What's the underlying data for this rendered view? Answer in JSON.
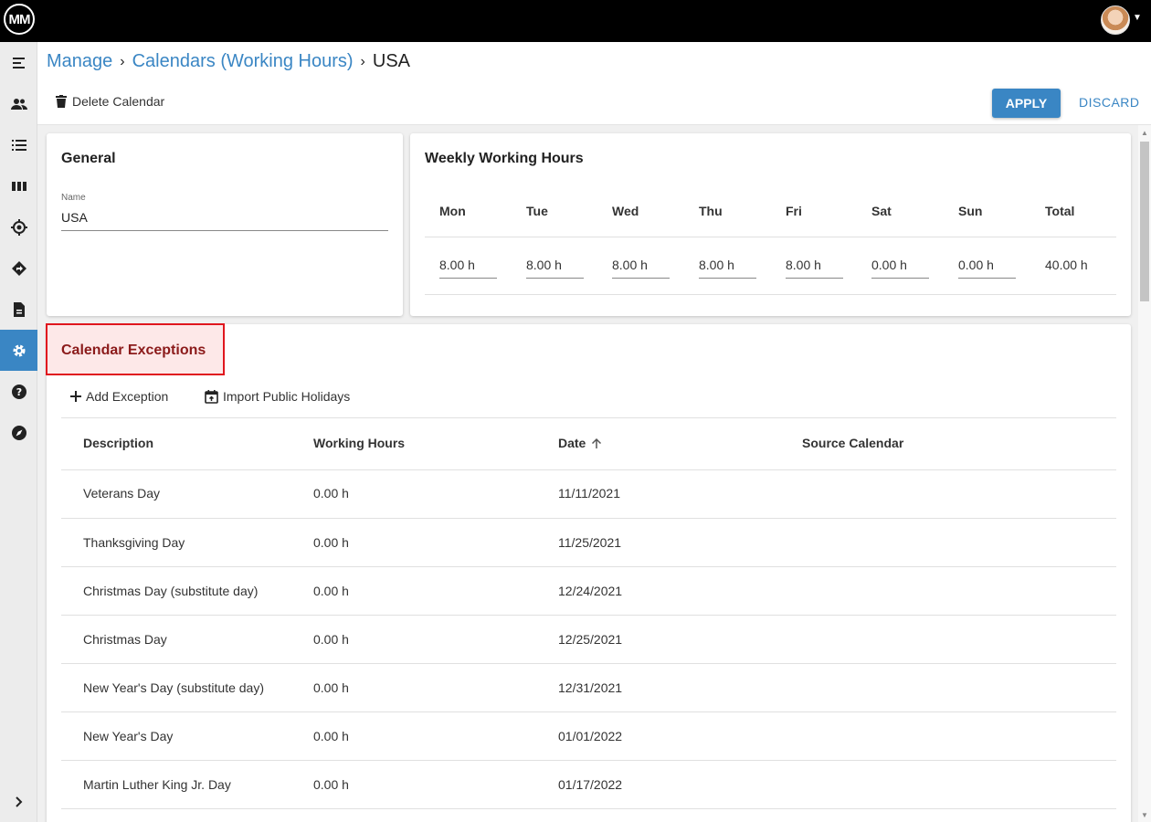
{
  "app": {
    "logo_text": "MM"
  },
  "breadcrumb": {
    "items": [
      "Manage",
      "Calendars (Working Hours)"
    ],
    "current": "USA",
    "separator": "›"
  },
  "toolbar": {
    "delete_label": "Delete Calendar",
    "apply_label": "APPLY",
    "discard_label": "DISCARD"
  },
  "general": {
    "title": "General",
    "name_label": "Name",
    "name_value": "USA"
  },
  "weekly": {
    "title": "Weekly Working Hours",
    "days": [
      {
        "day": "Mon",
        "hours": "8.00 h"
      },
      {
        "day": "Tue",
        "hours": "8.00 h"
      },
      {
        "day": "Wed",
        "hours": "8.00 h"
      },
      {
        "day": "Thu",
        "hours": "8.00 h"
      },
      {
        "day": "Fri",
        "hours": "8.00 h"
      },
      {
        "day": "Sat",
        "hours": "0.00 h"
      },
      {
        "day": "Sun",
        "hours": "0.00 h"
      }
    ],
    "total_label": "Total",
    "total_value": "40.00 h"
  },
  "exceptions": {
    "title": "Calendar Exceptions",
    "add_label": "Add Exception",
    "import_label": "Import Public Holidays",
    "columns": [
      "Description",
      "Working Hours",
      "Date",
      "Source Calendar"
    ],
    "rows": [
      {
        "description": "Veterans Day",
        "hours": "0.00 h",
        "date": "11/11/2021",
        "source": ""
      },
      {
        "description": "Thanksgiving Day",
        "hours": "0.00 h",
        "date": "11/25/2021",
        "source": ""
      },
      {
        "description": "Christmas Day (substitute day)",
        "hours": "0.00 h",
        "date": "12/24/2021",
        "source": ""
      },
      {
        "description": "Christmas Day",
        "hours": "0.00 h",
        "date": "12/25/2021",
        "source": ""
      },
      {
        "description": "New Year's Day (substitute day)",
        "hours": "0.00 h",
        "date": "12/31/2021",
        "source": ""
      },
      {
        "description": "New Year's Day",
        "hours": "0.00 h",
        "date": "01/01/2022",
        "source": ""
      },
      {
        "description": "Martin Luther King Jr. Day",
        "hours": "0.00 h",
        "date": "01/17/2022",
        "source": ""
      }
    ]
  },
  "sidebar": {
    "icons": [
      "menu-icon",
      "people-icon",
      "list-icon",
      "columns-icon",
      "target-icon",
      "route-icon",
      "document-icon",
      "gear-icon",
      "help-icon",
      "compass-icon"
    ],
    "active": "gear-icon",
    "expand_icon": "chevron-right-icon"
  },
  "colors": {
    "accent": "#3a86c4",
    "highlight_border": "#e0161e",
    "highlight_bg": "#fde8e8"
  }
}
